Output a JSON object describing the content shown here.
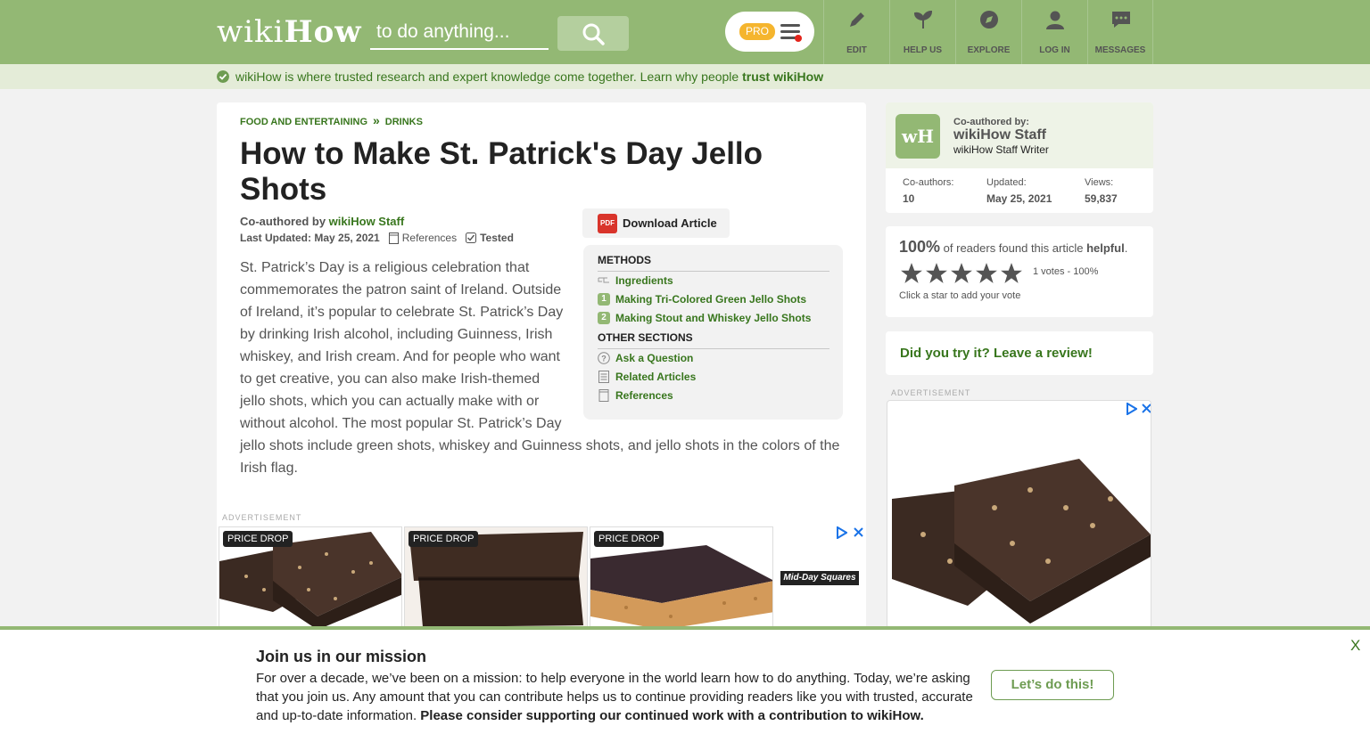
{
  "header": {
    "logo_thin": "wiki",
    "logo_bold": "How",
    "search_placeholder": "to do anything...",
    "pro_label": "PRO",
    "nav": [
      {
        "label": "EDIT",
        "icon": "pencil-icon"
      },
      {
        "label": "HELP US",
        "icon": "sprout-icon"
      },
      {
        "label": "EXPLORE",
        "icon": "compass-icon"
      },
      {
        "label": "LOG IN",
        "icon": "user-icon"
      },
      {
        "label": "MESSAGES",
        "icon": "chat-icon"
      }
    ]
  },
  "trust": {
    "text": "wikiHow is where trusted research and expert knowledge come together. Learn why people ",
    "link": "trust wikiHow"
  },
  "article": {
    "breadcrumbs": [
      "FOOD AND ENTERTAINING",
      "DRINKS"
    ],
    "title": "How to Make St. Patrick's Day Jello Shots",
    "coauthored_prefix": "Co-authored by ",
    "coauthor": "wikiHow Staff",
    "last_updated": "Last Updated: May 25, 2021",
    "references_label": "References",
    "tested_label": "Tested",
    "download_label": "Download Article",
    "pdf_label": "PDF",
    "intro": "St. Patrick’s Day is a religious celebration that commemorates the patron saint of Ireland. Outside of Ireland, it’s popular to celebrate St. Patrick’s Day by drinking Irish alcohol, including Guinness, Irish whiskey, and Irish cream. And for people who want to get creative, you can also make Irish-themed jello shots, which you can actually make with or without alcohol. The most popular St. Patrick’s Day jello shots include green shots, whiskey and Guinness shots, and jello shots in the colors of the Irish flag."
  },
  "toc": {
    "methods_heading": "METHODS",
    "ingredients": "Ingredients",
    "methods": [
      {
        "num": "1",
        "label": "Making Tri-Colored Green Jello Shots"
      },
      {
        "num": "2",
        "label": "Making Stout and Whiskey Jello Shots"
      }
    ],
    "other_heading": "OTHER SECTIONS",
    "other": [
      "Ask a Question",
      "Related Articles",
      "References"
    ]
  },
  "ads": {
    "label": "ADVERTISEMENT",
    "badge": "PRICE DROP",
    "brand": "Mid-Day Squares"
  },
  "sidebar": {
    "coauthored_label": "Co-authored by:",
    "author_name": "wikiHow Staff",
    "author_role": "wikiHow Staff Writer",
    "logo_text": "wH",
    "stats": [
      {
        "label": "Co-authors:",
        "value": "10"
      },
      {
        "label": "Updated:",
        "value": "May 25, 2021"
      },
      {
        "label": "Views:",
        "value": "59,837"
      }
    ],
    "helpful_pct": "100%",
    "helpful_text_a": " of readers found this article ",
    "helpful_text_b": "helpful",
    "rating_stars": 5,
    "votes": "1 votes - 100%",
    "click_star": "Click a star to add your vote",
    "review_link": "Did you try it? Leave a review!"
  },
  "banner": {
    "title": "Join us in our mission",
    "text": "For over a decade, we’ve been on a mission: to help everyone in the world learn how to do anything. Today, we’re asking that you join us. Any amount that you can contribute helps us to continue providing readers like you with trusted, accurate and up-to-date information. ",
    "text_bold": "Please consider supporting our continued work with a contribution to wikiHow.",
    "button": "Let’s do this!",
    "close": "X"
  },
  "colors": {
    "brand_green": "#93b874",
    "link_green": "#38761d",
    "pro_yellow": "#f5b52e"
  }
}
